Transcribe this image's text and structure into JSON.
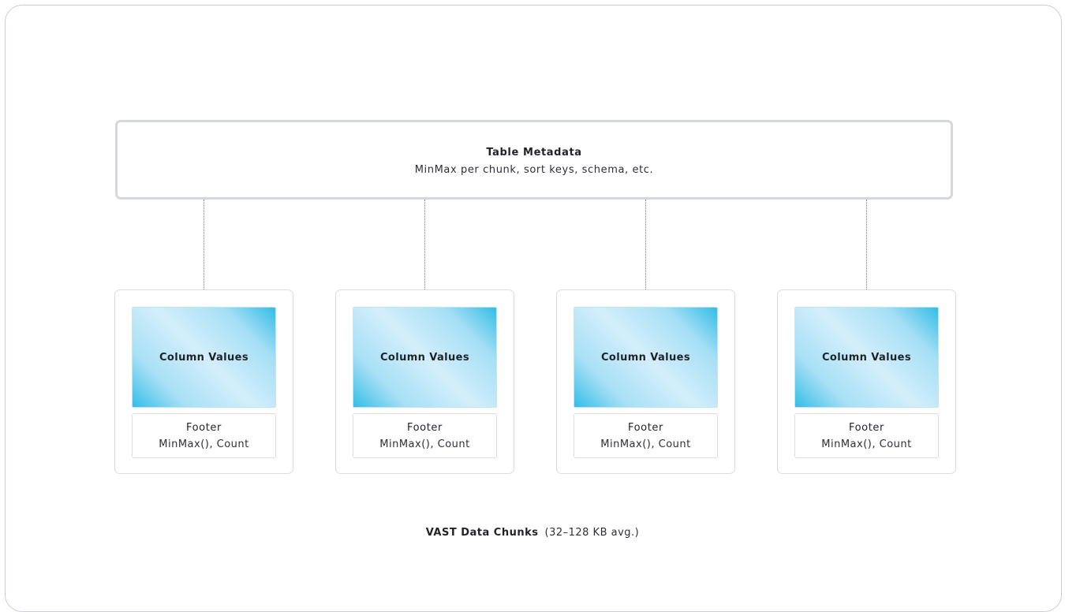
{
  "metadata": {
    "title": "Table Metadata",
    "subtitle": "MinMax per chunk, sort keys, schema, etc."
  },
  "chunks": [
    {
      "values_label": "Column Values",
      "footer_title": "Footer",
      "footer_sub": "MinMax(), Count"
    },
    {
      "values_label": "Column Values",
      "footer_title": "Footer",
      "footer_sub": "MinMax(), Count"
    },
    {
      "values_label": "Column Values",
      "footer_title": "Footer",
      "footer_sub": "MinMax(), Count"
    },
    {
      "values_label": "Column Values",
      "footer_title": "Footer",
      "footer_sub": "MinMax(), Count"
    }
  ],
  "caption": {
    "strong": "VAST Data Chunks",
    "note": "(32–128 KB avg.)"
  },
  "colors": {
    "values_gradient_edge": "#35bde6",
    "values_gradient_center": "#d3eefb",
    "border": "#d4d7dc"
  }
}
